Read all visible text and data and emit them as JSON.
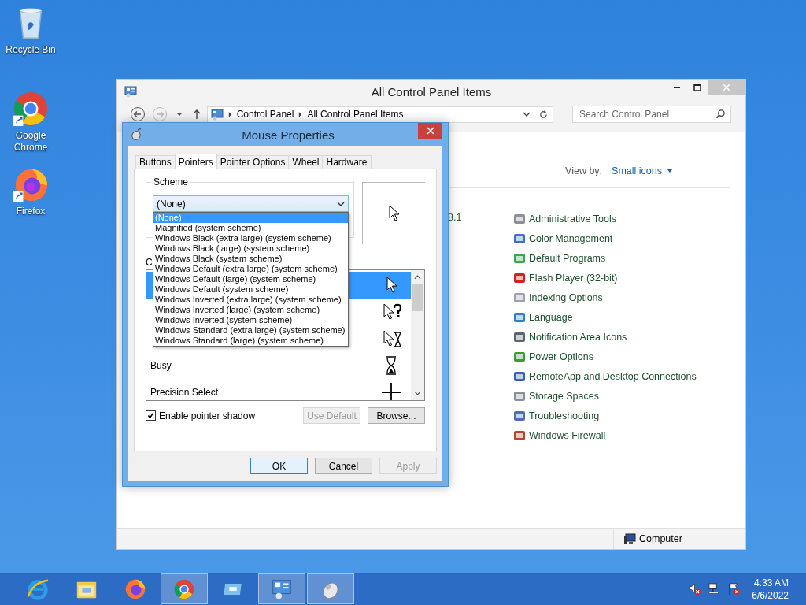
{
  "desktop_icons": [
    {
      "label": "Recycle Bin",
      "kind": "bin"
    },
    {
      "label": "Google Chrome",
      "kind": "chrome"
    },
    {
      "label": "Firefox",
      "kind": "firefox"
    }
  ],
  "control_panel": {
    "title": "All Control Panel Items",
    "breadcrumb": [
      "Control Panel",
      "All Control Panel Items"
    ],
    "search": {
      "placeholder": "Search Control Panel"
    },
    "view_by": {
      "label": "View by:",
      "value": "Small icons"
    },
    "column_1_fragment": "8.1",
    "items": [
      {
        "label": "Administrative Tools",
        "color": "#8a8f99"
      },
      {
        "label": "Color Management",
        "color": "#3a6fd0"
      },
      {
        "label": "Default Programs",
        "color": "#3aa84a"
      },
      {
        "label": "Flash Player (32-bit)",
        "color": "#d42020"
      },
      {
        "label": "Indexing Options",
        "color": "#9aa3ad"
      },
      {
        "label": "Language",
        "color": "#2f7fd0"
      },
      {
        "label": "Notification Area Icons",
        "color": "#5a6470"
      },
      {
        "label": "Power Options",
        "color": "#3c9a3c"
      },
      {
        "label": "RemoteApp and Desktop Connections",
        "color": "#3a5fc0"
      },
      {
        "label": "Storage Spaces",
        "color": "#8a8f99"
      },
      {
        "label": "Troubleshooting",
        "color": "#4a6fb0"
      },
      {
        "label": "Windows Firewall",
        "color": "#b04a2a"
      }
    ],
    "status_bar": "Computer"
  },
  "dialog": {
    "title": "Mouse Properties",
    "tabs": [
      {
        "label": "Buttons",
        "selected": false
      },
      {
        "label": "Pointers",
        "selected": true
      },
      {
        "label": "Pointer Options",
        "selected": false
      },
      {
        "label": "Wheel",
        "selected": false
      },
      {
        "label": "Hardware",
        "selected": false
      }
    ],
    "scheme": {
      "label": "Scheme",
      "value": "(None)",
      "expanded": true,
      "options": [
        {
          "label": "(None)",
          "selected": true
        },
        {
          "label": "Magnified (system scheme)",
          "selected": false
        },
        {
          "label": "Windows Black (extra large) (system scheme)",
          "selected": false
        },
        {
          "label": "Windows Black (large) (system scheme)",
          "selected": false
        },
        {
          "label": "Windows Black (system scheme)",
          "selected": false
        },
        {
          "label": "Windows Default (extra large) (system scheme)",
          "selected": false
        },
        {
          "label": "Windows Default (large) (system scheme)",
          "selected": false
        },
        {
          "label": "Windows Default (system scheme)",
          "selected": false
        },
        {
          "label": "Windows Inverted (extra large) (system scheme)",
          "selected": false
        },
        {
          "label": "Windows Inverted (large) (system scheme)",
          "selected": false
        },
        {
          "label": "Windows Inverted (system scheme)",
          "selected": false
        },
        {
          "label": "Windows Standard (extra large) (system scheme)",
          "selected": false
        },
        {
          "label": "Windows Standard (large) (system scheme)",
          "selected": false
        }
      ]
    },
    "customize_label": "C",
    "pointers": [
      {
        "kind": "arrow",
        "selected": true
      },
      {
        "kind": "help",
        "selected": false
      },
      {
        "kind": "working",
        "selected": false
      },
      {
        "kind": "busy",
        "label": "Busy",
        "selected": false
      },
      {
        "kind": "cross",
        "label": "Precision Select",
        "selected": false
      }
    ],
    "shadow": {
      "label": "Enable pointer shadow",
      "checked": true
    },
    "use_default": {
      "label": "Use Default",
      "disabled": true
    },
    "browse": {
      "label": "Browse...",
      "disabled": false
    },
    "buttons": [
      {
        "label": "OK",
        "default": true,
        "disabled": false
      },
      {
        "label": "Cancel",
        "default": false,
        "disabled": false
      },
      {
        "label": "Apply",
        "default": false,
        "disabled": true
      }
    ]
  },
  "taskbar": {
    "apps": [
      {
        "kind": "ie",
        "active": false
      },
      {
        "kind": "folder",
        "active": false
      },
      {
        "kind": "firefox",
        "active": false
      },
      {
        "kind": "chrome",
        "active": true
      },
      {
        "kind": "explorer",
        "active": false
      },
      {
        "kind": "control",
        "active": true
      },
      {
        "kind": "mouse",
        "active": true
      }
    ],
    "tray": [
      {
        "kind": "volume"
      },
      {
        "kind": "network"
      },
      {
        "kind": "flag"
      }
    ],
    "time": "4:33 AM",
    "date": "6/6/2022"
  }
}
